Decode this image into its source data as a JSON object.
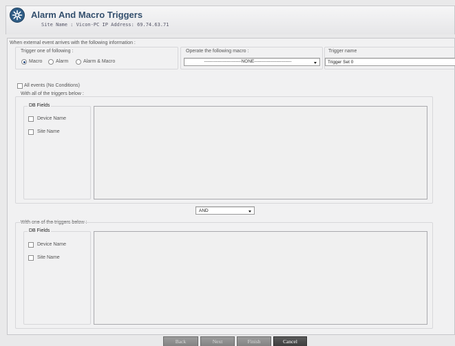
{
  "header": {
    "title": "Alarm And Macro Triggers",
    "subtitle": "Site Name : Vicon-PC  IP Address: 69.74.63.71"
  },
  "main": {
    "intro": "When external event arrives with the following information :",
    "trigger_group": {
      "legend": "Trigger one of following :",
      "options": [
        "Macro",
        "Alarm",
        "Alarm & Macro"
      ],
      "selected": "Macro"
    },
    "macro": {
      "label": "Operate the following macro :",
      "value": "-------------------------NONE-------------------------"
    },
    "trigger_name": {
      "label": "Trigger name",
      "value": "Trigger Set 0"
    },
    "all_events": {
      "label": "All events (No Conditions)",
      "checked": false
    },
    "all_triggers": {
      "legend": "With all of the triggers below :",
      "db_legend": "DB Fields",
      "fields": [
        "Device Name",
        "Site Name"
      ]
    },
    "combinator": {
      "value": "AND"
    },
    "one_triggers": {
      "legend": "With one of the triggers below :",
      "db_legend": "DB Fields",
      "fields": [
        "Device Name",
        "Site Name"
      ]
    }
  },
  "footer": {
    "back": "Back",
    "next": "Next",
    "finish": "Finish",
    "cancel": "Cancel"
  },
  "colors": {
    "title": "#334f6d",
    "accent": "#2f5d86",
    "button_dark": "#4a4a4a"
  }
}
